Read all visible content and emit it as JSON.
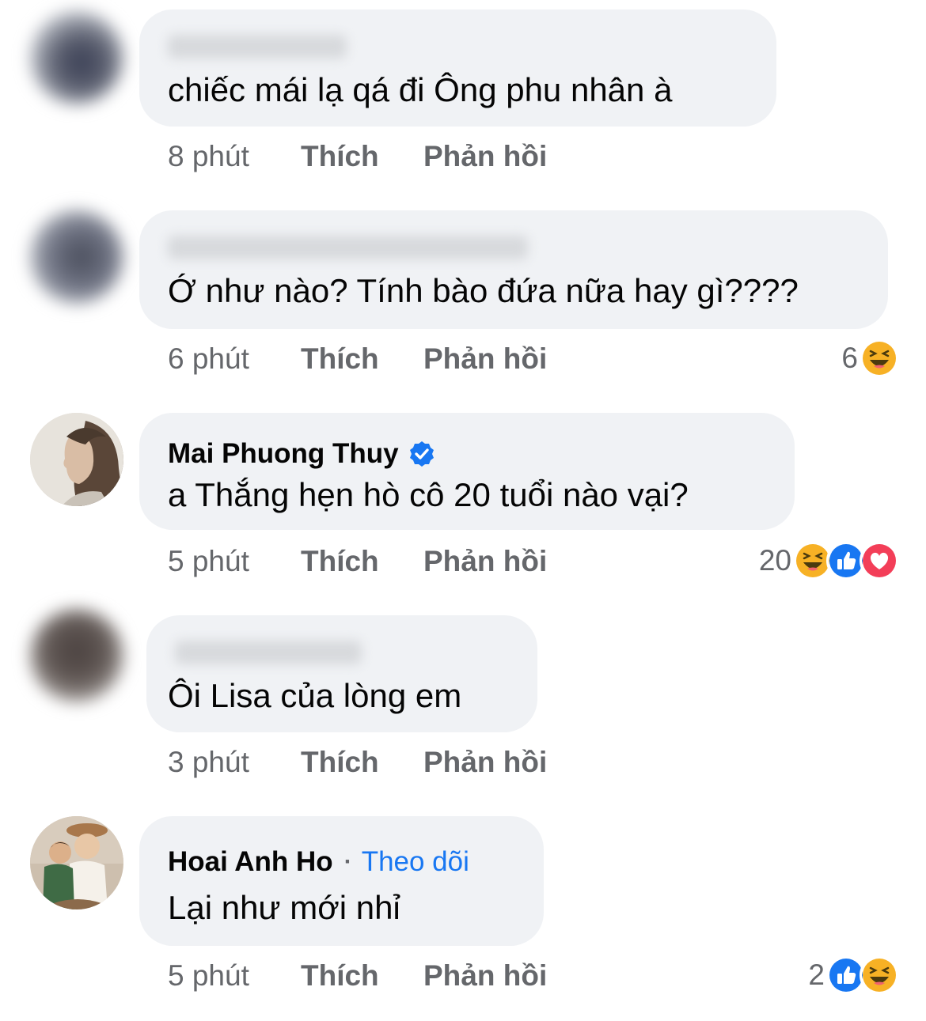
{
  "comments": [
    {
      "author": "",
      "author_blurred": true,
      "text": "chiếc mái lạ qá đi Ông phu nhân à",
      "time": "8 phút",
      "like_label": "Thích",
      "reply_label": "Phản hồi",
      "reaction_count": "",
      "reactions": []
    },
    {
      "author": "",
      "author_blurred": true,
      "text": "Ớ như nào? Tính bào đứa nữa hay gì????",
      "time": "6 phút",
      "like_label": "Thích",
      "reply_label": "Phản hồi",
      "reaction_count": "6",
      "reactions": [
        "haha-icon"
      ]
    },
    {
      "author": "Mai Phuong Thuy",
      "verified": true,
      "text": "a Thắng hẹn hò cô 20 tuổi nào vại?",
      "time": "5 phút",
      "like_label": "Thích",
      "reply_label": "Phản hồi",
      "reaction_count": "20",
      "reactions": [
        "haha-icon",
        "like-icon",
        "love-icon"
      ]
    },
    {
      "author": "",
      "author_blurred": true,
      "text": "Ôi Lisa của lòng em",
      "time": "3 phút",
      "like_label": "Thích",
      "reply_label": "Phản hồi",
      "reaction_count": "",
      "reactions": []
    },
    {
      "author": "Hoai Anh Ho",
      "separator": "·",
      "follow_label": "Theo dõi",
      "text": "Lại như mới nhỉ",
      "time": "5 phút",
      "like_label": "Thích",
      "reply_label": "Phản hồi",
      "reaction_count": "2",
      "reactions": [
        "like-icon",
        "haha-icon"
      ]
    }
  ],
  "colors": {
    "bubble": "#f0f2f5",
    "meta_text": "#65676b",
    "link_blue": "#1877f2",
    "love_red": "#f33e58",
    "haha_yellow": "#f7b125"
  }
}
